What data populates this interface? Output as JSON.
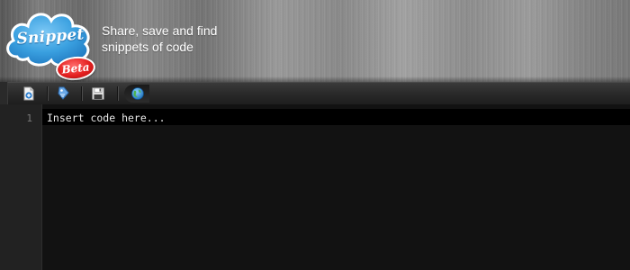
{
  "header": {
    "logo": {
      "text": "Snippet",
      "badge": "Beta",
      "cloud_color": "#3aa0e0",
      "badge_color": "#e02a2a"
    },
    "tagline": {
      "line1": "Share, save and find",
      "line2": "snippets of code"
    }
  },
  "toolbar": {
    "buttons": [
      {
        "name": "new-snippet",
        "icon": "new-document-icon"
      },
      {
        "name": "tag",
        "icon": "tag-icon"
      },
      {
        "name": "save",
        "icon": "floppy-disk-icon"
      },
      {
        "name": "share",
        "icon": "globe-icon"
      }
    ]
  },
  "editor": {
    "line_numbers": [
      "1"
    ],
    "placeholder": "Insert code here...",
    "background": "#121212",
    "gutter_background": "#222222"
  }
}
